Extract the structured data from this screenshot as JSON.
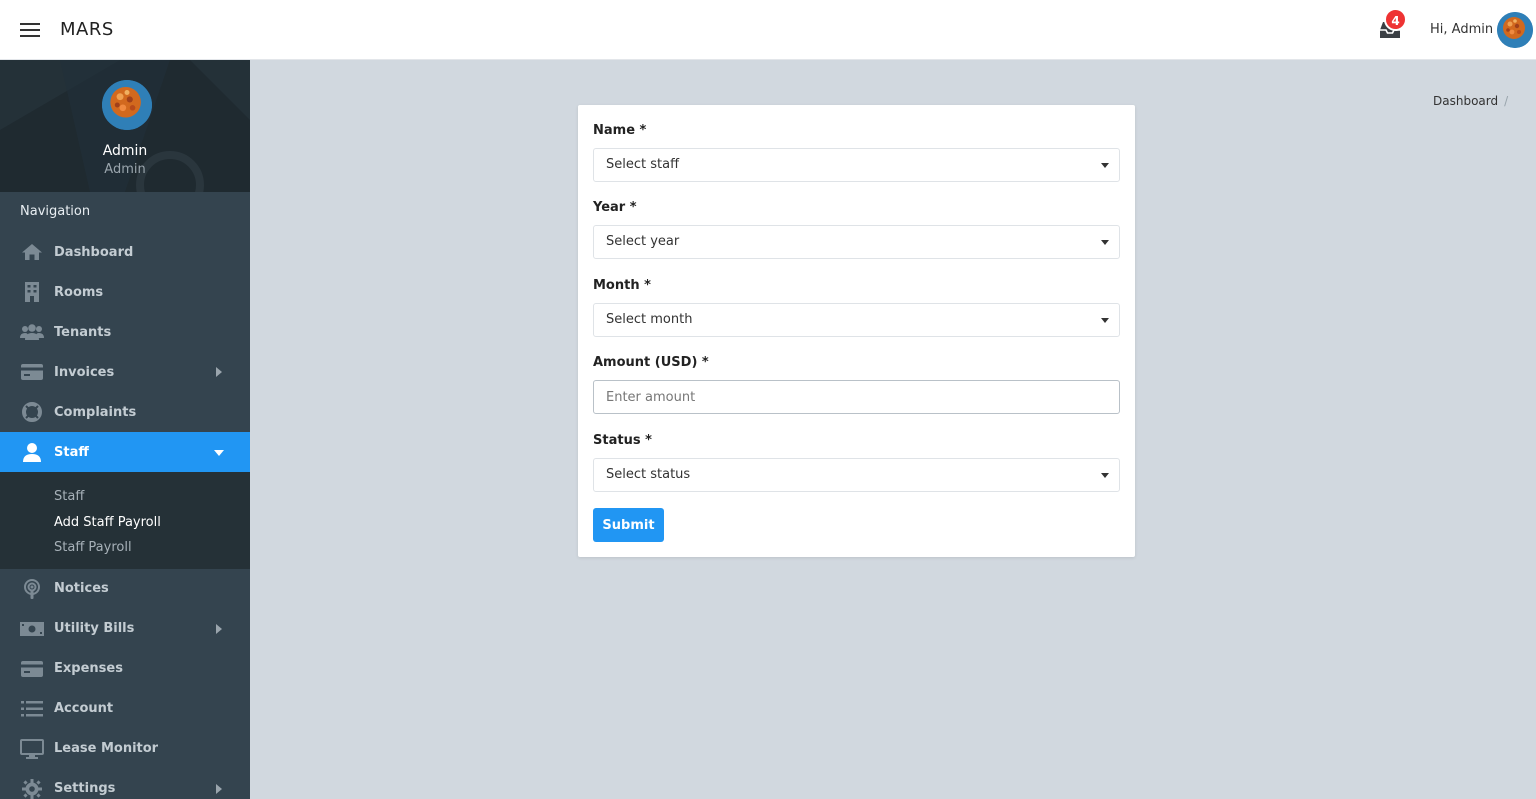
{
  "header": {
    "brand": "MARS",
    "notification_count": "4",
    "greeting": "Hi, Admin"
  },
  "profile": {
    "name": "Admin",
    "role": "Admin"
  },
  "sidebar": {
    "title": "Navigation",
    "items": [
      {
        "label": "Dashboard",
        "icon": "home-icon"
      },
      {
        "label": "Rooms",
        "icon": "building-icon"
      },
      {
        "label": "Tenants",
        "icon": "users-icon"
      },
      {
        "label": "Invoices",
        "icon": "credit-card-icon",
        "has_submenu": true
      },
      {
        "label": "Complaints",
        "icon": "life-ring-icon"
      },
      {
        "label": "Staff",
        "icon": "user-icon",
        "active": true,
        "expanded": true
      },
      {
        "label": "Notices",
        "icon": "podcast-icon"
      },
      {
        "label": "Utility Bills",
        "icon": "money-bill-icon",
        "has_submenu": true
      },
      {
        "label": "Expenses",
        "icon": "credit-card-icon"
      },
      {
        "label": "Account",
        "icon": "list-icon"
      },
      {
        "label": "Lease Monitor",
        "icon": "desktop-icon"
      },
      {
        "label": "Settings",
        "icon": "gear-icon",
        "has_submenu": true
      }
    ],
    "staff_submenu": [
      "Staff",
      "Add Staff Payroll",
      "Staff Payroll"
    ],
    "current_submenu": "Add Staff Payroll"
  },
  "breadcrumb": {
    "items": [
      "Dashboard"
    ],
    "separator": "/"
  },
  "form": {
    "name_label": "Name *",
    "name_placeholder": "Select staff",
    "year_label": "Year *",
    "year_placeholder": "Select year",
    "month_label": "Month *",
    "month_placeholder": "Select month",
    "amount_label": "Amount (USD) *",
    "amount_placeholder": "Enter amount",
    "status_label": "Status *",
    "status_placeholder": "Select status",
    "submit_label": "Submit"
  },
  "colors": {
    "accent": "#2196f3",
    "sidebar_bg": "#34444f",
    "profile_bg": "#1f2a30",
    "page_bg": "#d1d8df",
    "badge": "#ee3333"
  }
}
